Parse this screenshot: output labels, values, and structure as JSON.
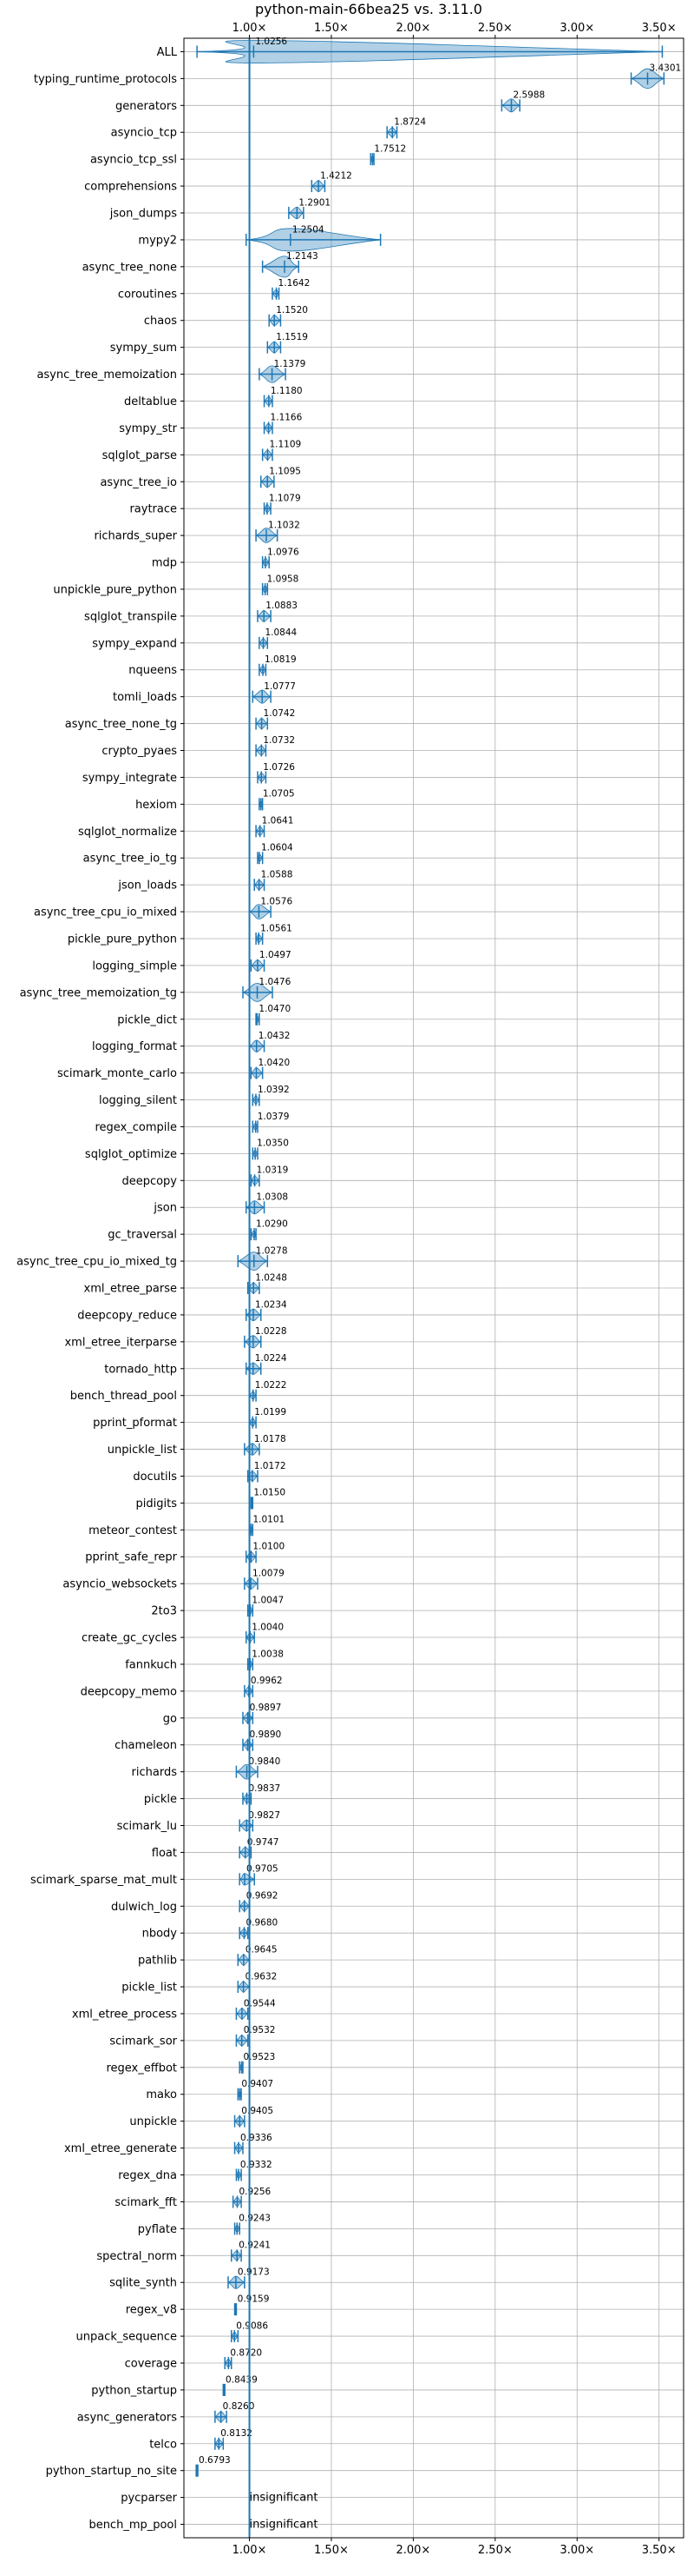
{
  "chart_data": {
    "type": "violin",
    "title": "python-main-66bea25 vs. 3.11.0",
    "xlabel": "",
    "ylabel": "",
    "xlim": [
      0.6,
      3.65
    ],
    "xticks": [
      1.0,
      1.5,
      2.0,
      2.5,
      3.0,
      3.5
    ],
    "xtick_labels": [
      "1.00×",
      "1.50×",
      "2.00×",
      "2.50×",
      "3.00×",
      "3.50×"
    ],
    "grid": true,
    "reference_line": 1.0,
    "colors": {
      "violin": "#1f77b4",
      "grid": "#b0b0b0",
      "text": "#000000"
    },
    "benchmarks": [
      {
        "name": "ALL",
        "median": 1.0256,
        "min": 0.68,
        "max": 3.52,
        "label": "1.0256"
      },
      {
        "name": "typing_runtime_protocols",
        "median": 3.4301,
        "min": 3.33,
        "max": 3.53,
        "label": "3.4301"
      },
      {
        "name": "generators",
        "median": 2.5988,
        "min": 2.54,
        "max": 2.65,
        "label": "2.5988"
      },
      {
        "name": "asyncio_tcp",
        "median": 1.8724,
        "min": 1.84,
        "max": 1.9,
        "label": "1.8724"
      },
      {
        "name": "asyncio_tcp_ssl",
        "median": 1.7512,
        "min": 1.74,
        "max": 1.76,
        "label": "1.7512"
      },
      {
        "name": "comprehensions",
        "median": 1.4212,
        "min": 1.38,
        "max": 1.46,
        "label": "1.4212"
      },
      {
        "name": "json_dumps",
        "median": 1.2901,
        "min": 1.24,
        "max": 1.33,
        "label": "1.2901"
      },
      {
        "name": "mypy2",
        "median": 1.2504,
        "min": 0.98,
        "max": 1.8,
        "label": "1.2504"
      },
      {
        "name": "async_tree_none",
        "median": 1.2143,
        "min": 1.08,
        "max": 1.3,
        "label": "1.2143"
      },
      {
        "name": "coroutines",
        "median": 1.1642,
        "min": 1.14,
        "max": 1.18,
        "label": "1.1642"
      },
      {
        "name": "chaos",
        "median": 1.152,
        "min": 1.12,
        "max": 1.19,
        "label": "1.1520"
      },
      {
        "name": "sympy_sum",
        "median": 1.1519,
        "min": 1.11,
        "max": 1.19,
        "label": "1.1519"
      },
      {
        "name": "async_tree_memoization",
        "median": 1.1379,
        "min": 1.06,
        "max": 1.22,
        "label": "1.1379"
      },
      {
        "name": "deltablue",
        "median": 1.118,
        "min": 1.09,
        "max": 1.14,
        "label": "1.1180"
      },
      {
        "name": "sympy_str",
        "median": 1.1166,
        "min": 1.09,
        "max": 1.14,
        "label": "1.1166"
      },
      {
        "name": "sqlglot_parse",
        "median": 1.1109,
        "min": 1.08,
        "max": 1.14,
        "label": "1.1109"
      },
      {
        "name": "async_tree_io",
        "median": 1.1095,
        "min": 1.07,
        "max": 1.15,
        "label": "1.1095"
      },
      {
        "name": "raytrace",
        "median": 1.1079,
        "min": 1.09,
        "max": 1.13,
        "label": "1.1079"
      },
      {
        "name": "richards_super",
        "median": 1.1032,
        "min": 1.04,
        "max": 1.17,
        "label": "1.1032"
      },
      {
        "name": "mdp",
        "median": 1.0976,
        "min": 1.08,
        "max": 1.12,
        "label": "1.0976"
      },
      {
        "name": "unpickle_pure_python",
        "median": 1.0958,
        "min": 1.08,
        "max": 1.11,
        "label": "1.0958"
      },
      {
        "name": "sqlglot_transpile",
        "median": 1.0883,
        "min": 1.05,
        "max": 1.13,
        "label": "1.0883"
      },
      {
        "name": "sympy_expand",
        "median": 1.0844,
        "min": 1.06,
        "max": 1.11,
        "label": "1.0844"
      },
      {
        "name": "nqueens",
        "median": 1.0819,
        "min": 1.06,
        "max": 1.1,
        "label": "1.0819"
      },
      {
        "name": "tomli_loads",
        "median": 1.0777,
        "min": 1.02,
        "max": 1.13,
        "label": "1.0777"
      },
      {
        "name": "async_tree_none_tg",
        "median": 1.0742,
        "min": 1.04,
        "max": 1.11,
        "label": "1.0742"
      },
      {
        "name": "crypto_pyaes",
        "median": 1.0732,
        "min": 1.04,
        "max": 1.1,
        "label": "1.0732"
      },
      {
        "name": "sympy_integrate",
        "median": 1.0726,
        "min": 1.05,
        "max": 1.1,
        "label": "1.0726"
      },
      {
        "name": "hexiom",
        "median": 1.0705,
        "min": 1.06,
        "max": 1.08,
        "label": "1.0705"
      },
      {
        "name": "sqlglot_normalize",
        "median": 1.0641,
        "min": 1.04,
        "max": 1.09,
        "label": "1.0641"
      },
      {
        "name": "async_tree_io_tg",
        "median": 1.0604,
        "min": 1.05,
        "max": 1.08,
        "label": "1.0604"
      },
      {
        "name": "json_loads",
        "median": 1.0588,
        "min": 1.03,
        "max": 1.09,
        "label": "1.0588"
      },
      {
        "name": "async_tree_cpu_io_mixed",
        "median": 1.0576,
        "min": 1.0,
        "max": 1.13,
        "label": "1.0576"
      },
      {
        "name": "pickle_pure_python",
        "median": 1.0561,
        "min": 1.04,
        "max": 1.08,
        "label": "1.0561"
      },
      {
        "name": "logging_simple",
        "median": 1.0497,
        "min": 1.01,
        "max": 1.09,
        "label": "1.0497"
      },
      {
        "name": "async_tree_memoization_tg",
        "median": 1.0476,
        "min": 0.96,
        "max": 1.14,
        "label": "1.0476"
      },
      {
        "name": "pickle_dict",
        "median": 1.047,
        "min": 1.04,
        "max": 1.06,
        "label": "1.0470"
      },
      {
        "name": "logging_format",
        "median": 1.0432,
        "min": 1.0,
        "max": 1.09,
        "label": "1.0432"
      },
      {
        "name": "scimark_monte_carlo",
        "median": 1.042,
        "min": 1.01,
        "max": 1.08,
        "label": "1.0420"
      },
      {
        "name": "logging_silent",
        "median": 1.0392,
        "min": 1.02,
        "max": 1.06,
        "label": "1.0392"
      },
      {
        "name": "regex_compile",
        "median": 1.0379,
        "min": 1.02,
        "max": 1.05,
        "label": "1.0379"
      },
      {
        "name": "sqlglot_optimize",
        "median": 1.035,
        "min": 1.02,
        "max": 1.05,
        "label": "1.0350"
      },
      {
        "name": "deepcopy",
        "median": 1.0319,
        "min": 1.01,
        "max": 1.06,
        "label": "1.0319"
      },
      {
        "name": "json",
        "median": 1.0308,
        "min": 0.98,
        "max": 1.09,
        "label": "1.0308"
      },
      {
        "name": "gc_traversal",
        "median": 1.029,
        "min": 1.01,
        "max": 1.04,
        "label": "1.0290"
      },
      {
        "name": "async_tree_cpu_io_mixed_tg",
        "median": 1.0278,
        "min": 0.93,
        "max": 1.11,
        "label": "1.0278"
      },
      {
        "name": "xml_etree_parse",
        "median": 1.0248,
        "min": 0.99,
        "max": 1.06,
        "label": "1.0248"
      },
      {
        "name": "deepcopy_reduce",
        "median": 1.0234,
        "min": 0.98,
        "max": 1.07,
        "label": "1.0234"
      },
      {
        "name": "xml_etree_iterparse",
        "median": 1.0228,
        "min": 0.97,
        "max": 1.07,
        "label": "1.0228"
      },
      {
        "name": "tornado_http",
        "median": 1.0224,
        "min": 0.98,
        "max": 1.07,
        "label": "1.0224"
      },
      {
        "name": "bench_thread_pool",
        "median": 1.0222,
        "min": 1.0,
        "max": 1.04,
        "label": "1.0222"
      },
      {
        "name": "pprint_pformat",
        "median": 1.0199,
        "min": 1.0,
        "max": 1.04,
        "label": "1.0199"
      },
      {
        "name": "unpickle_list",
        "median": 1.0178,
        "min": 0.97,
        "max": 1.06,
        "label": "1.0178"
      },
      {
        "name": "docutils",
        "median": 1.0172,
        "min": 0.99,
        "max": 1.05,
        "label": "1.0172"
      },
      {
        "name": "pidigits",
        "median": 1.015,
        "min": 1.01,
        "max": 1.02,
        "label": "1.0150"
      },
      {
        "name": "meteor_contest",
        "median": 1.0101,
        "min": 1.0,
        "max": 1.02,
        "label": "1.0101"
      },
      {
        "name": "pprint_safe_repr",
        "median": 1.01,
        "min": 0.98,
        "max": 1.04,
        "label": "1.0100"
      },
      {
        "name": "asyncio_websockets",
        "median": 1.0079,
        "min": 0.97,
        "max": 1.05,
        "label": "1.0079"
      },
      {
        "name": "2to3",
        "median": 1.0047,
        "min": 0.99,
        "max": 1.02,
        "label": "1.0047"
      },
      {
        "name": "create_gc_cycles",
        "median": 1.004,
        "min": 0.98,
        "max": 1.03,
        "label": "1.0040"
      },
      {
        "name": "fannkuch",
        "median": 1.0038,
        "min": 0.99,
        "max": 1.02,
        "label": "1.0038"
      },
      {
        "name": "deepcopy_memo",
        "median": 0.9962,
        "min": 0.97,
        "max": 1.02,
        "label": "0.9962"
      },
      {
        "name": "go",
        "median": 0.9897,
        "min": 0.96,
        "max": 1.02,
        "label": "0.9897"
      },
      {
        "name": "chameleon",
        "median": 0.989,
        "min": 0.96,
        "max": 1.02,
        "label": "0.9890"
      },
      {
        "name": "richards",
        "median": 0.984,
        "min": 0.92,
        "max": 1.05,
        "label": "0.9840"
      },
      {
        "name": "pickle",
        "median": 0.9837,
        "min": 0.96,
        "max": 1.01,
        "label": "0.9837"
      },
      {
        "name": "scimark_lu",
        "median": 0.9827,
        "min": 0.94,
        "max": 1.02,
        "label": "0.9827"
      },
      {
        "name": "float",
        "median": 0.9747,
        "min": 0.94,
        "max": 1.01,
        "label": "0.9747"
      },
      {
        "name": "scimark_sparse_mat_mult",
        "median": 0.9705,
        "min": 0.94,
        "max": 1.03,
        "label": "0.9705"
      },
      {
        "name": "dulwich_log",
        "median": 0.9692,
        "min": 0.94,
        "max": 1.0,
        "label": "0.9692"
      },
      {
        "name": "nbody",
        "median": 0.968,
        "min": 0.94,
        "max": 0.99,
        "label": "0.9680"
      },
      {
        "name": "pathlib",
        "median": 0.9645,
        "min": 0.93,
        "max": 1.0,
        "label": "0.9645"
      },
      {
        "name": "pickle_list",
        "median": 0.9632,
        "min": 0.93,
        "max": 1.0,
        "label": "0.9632"
      },
      {
        "name": "xml_etree_process",
        "median": 0.9544,
        "min": 0.92,
        "max": 0.99,
        "label": "0.9544"
      },
      {
        "name": "scimark_sor",
        "median": 0.9532,
        "min": 0.92,
        "max": 0.99,
        "label": "0.9532"
      },
      {
        "name": "regex_effbot",
        "median": 0.9523,
        "min": 0.94,
        "max": 0.96,
        "label": "0.9523"
      },
      {
        "name": "mako",
        "median": 0.9407,
        "min": 0.93,
        "max": 0.95,
        "label": "0.9407"
      },
      {
        "name": "unpickle",
        "median": 0.9405,
        "min": 0.91,
        "max": 0.97,
        "label": "0.9405"
      },
      {
        "name": "xml_etree_generate",
        "median": 0.9336,
        "min": 0.91,
        "max": 0.96,
        "label": "0.9336"
      },
      {
        "name": "regex_dna",
        "median": 0.9332,
        "min": 0.92,
        "max": 0.95,
        "label": "0.9332"
      },
      {
        "name": "scimark_fft",
        "median": 0.9256,
        "min": 0.9,
        "max": 0.95,
        "label": "0.9256"
      },
      {
        "name": "pyflate",
        "median": 0.9243,
        "min": 0.91,
        "max": 0.94,
        "label": "0.9243"
      },
      {
        "name": "spectral_norm",
        "median": 0.9241,
        "min": 0.89,
        "max": 0.95,
        "label": "0.9241"
      },
      {
        "name": "sqlite_synth",
        "median": 0.9173,
        "min": 0.87,
        "max": 0.97,
        "label": "0.9173"
      },
      {
        "name": "regex_v8",
        "median": 0.9159,
        "min": 0.91,
        "max": 0.92,
        "label": "0.9159"
      },
      {
        "name": "unpack_sequence",
        "median": 0.9086,
        "min": 0.89,
        "max": 0.93,
        "label": "0.9086"
      },
      {
        "name": "coverage",
        "median": 0.872,
        "min": 0.85,
        "max": 0.89,
        "label": "0.8720"
      },
      {
        "name": "python_startup",
        "median": 0.8439,
        "min": 0.84,
        "max": 0.85,
        "label": "0.8439"
      },
      {
        "name": "async_generators",
        "median": 0.826,
        "min": 0.79,
        "max": 0.86,
        "label": "0.8260"
      },
      {
        "name": "telco",
        "median": 0.8132,
        "min": 0.79,
        "max": 0.84,
        "label": "0.8132"
      },
      {
        "name": "python_startup_no_site",
        "median": 0.6793,
        "min": 0.675,
        "max": 0.685,
        "label": "0.6793"
      },
      {
        "name": "pycparser",
        "median": null,
        "min": null,
        "max": null,
        "label": "insignificant"
      },
      {
        "name": "bench_mp_pool",
        "median": null,
        "min": null,
        "max": null,
        "label": "insignificant"
      }
    ]
  }
}
